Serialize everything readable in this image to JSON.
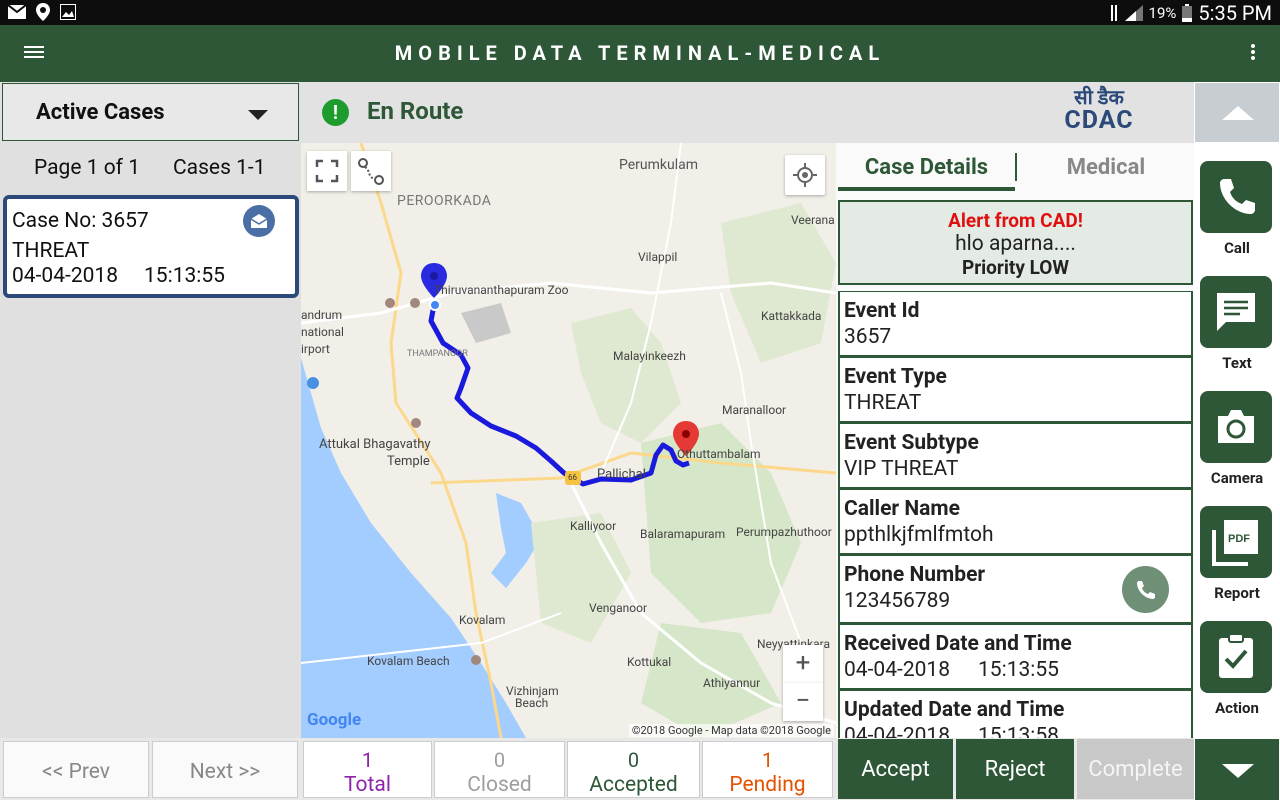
{
  "status_bar": {
    "battery": "19%",
    "time": "5:35 PM",
    "icons": [
      "mail-icon",
      "location-icon",
      "image-icon",
      "data-icon",
      "signal-icon",
      "battery-icon"
    ]
  },
  "app_bar": {
    "title": "MOBILE DATA TERMINAL-MEDICAL",
    "icons": [
      "hamburger-menu-icon",
      "overflow-menu-icon"
    ]
  },
  "left_panel": {
    "dropdown_label": "Active Cases",
    "page_info": "Page 1 of 1",
    "cases_info": "Cases 1-1",
    "cases": [
      {
        "case_no": "Case No: 3657",
        "type": "THREAT",
        "date": "04-04-2018",
        "time": "15:13:55",
        "icon": "mail-open-icon"
      }
    ],
    "prev_label": "<< Prev",
    "next_label": "Next >>"
  },
  "status_strip": {
    "status": "En Route",
    "logo_line1": "सी डैक",
    "logo_line2": "CDAC"
  },
  "map": {
    "labels": {
      "perumkulam": "Perumkulam",
      "peroorkada": "PEROORKADA",
      "veerana": "Veerana",
      "vilappil": "Vilappil",
      "zoo": "Thiruvananthapuram Zoo",
      "andrum": "andrum",
      "national": "national",
      "irport": "irport",
      "thampanoor": "THAMPANOOR",
      "kattakkada": "Kattakkada",
      "malayinkeezh": "Malayinkeezh",
      "maranalloor": "Maranalloor",
      "attukal": "Attukal Bhagavathy",
      "temple": "Temple",
      "ottuttambalam": "Othuttambalam",
      "pallichal": "Pallichal",
      "kalliyoor": "Kalliyoor",
      "balaramapuram": "Balaramapuram",
      "perumpazhuthoor": "Perumpazhuthoor",
      "venganoor": "Venganoor",
      "neyyattinkara": "Neyyattinkara",
      "kovalam": "Kovalam",
      "kovalam_beach": "Kovalam Beach",
      "kottukal": "Kottukal",
      "athiyannur": "Athiyannur",
      "vizhinjam": "Vizhinjam",
      "beach": "Beach",
      "road": "66"
    },
    "google": "Google",
    "copyright": "©2018 Google - Map data ©2018 Google",
    "zoom_in": "+",
    "zoom_out": "−"
  },
  "details": {
    "tabs": [
      {
        "label": "Case Details",
        "active": true
      },
      {
        "label": "Medical",
        "active": false
      }
    ],
    "alert": {
      "title": "Alert from CAD!",
      "message": "hlo aparna....",
      "priority": "Priority LOW"
    },
    "fields": [
      {
        "label": "Event Id",
        "value": "3657"
      },
      {
        "label": "Event Type",
        "value": "THREAT"
      },
      {
        "label": "Event Subtype",
        "value": "VIP THREAT"
      },
      {
        "label": "Caller Name",
        "value": "ppthlkjfmlfmtoh"
      },
      {
        "label": "Phone Number",
        "value": "123456789"
      },
      {
        "label": "Received Date and Time",
        "value": "04-04-2018",
        "value2": "15:13:55"
      },
      {
        "label": "Updated Date and Time",
        "value": "04-04-2018",
        "value2": "15:13:58"
      }
    ]
  },
  "rail": {
    "actions": [
      {
        "label": "Call",
        "icon": "phone-icon"
      },
      {
        "label": "Text",
        "icon": "message-icon"
      },
      {
        "label": "Camera",
        "icon": "camera-icon"
      },
      {
        "label": "Report",
        "icon": "pdf-icon"
      },
      {
        "label": "Action",
        "icon": "clipboard-check-icon"
      }
    ]
  },
  "counts": [
    {
      "num": "1",
      "label": "Total",
      "color": "#8e24aa"
    },
    {
      "num": "0",
      "label": "Closed",
      "color": "#9e9e9e"
    },
    {
      "num": "0",
      "label": "Accepted",
      "color": "#2e5738"
    },
    {
      "num": "1",
      "label": "Pending",
      "color": "#e65100"
    }
  ],
  "actions": {
    "accept": "Accept",
    "reject": "Reject",
    "complete": "Complete"
  },
  "colors": {
    "primary": "#2e5738",
    "alert_red": "#e01010",
    "card_border": "#2b4a7a",
    "route_blue": "#1a1adc"
  }
}
